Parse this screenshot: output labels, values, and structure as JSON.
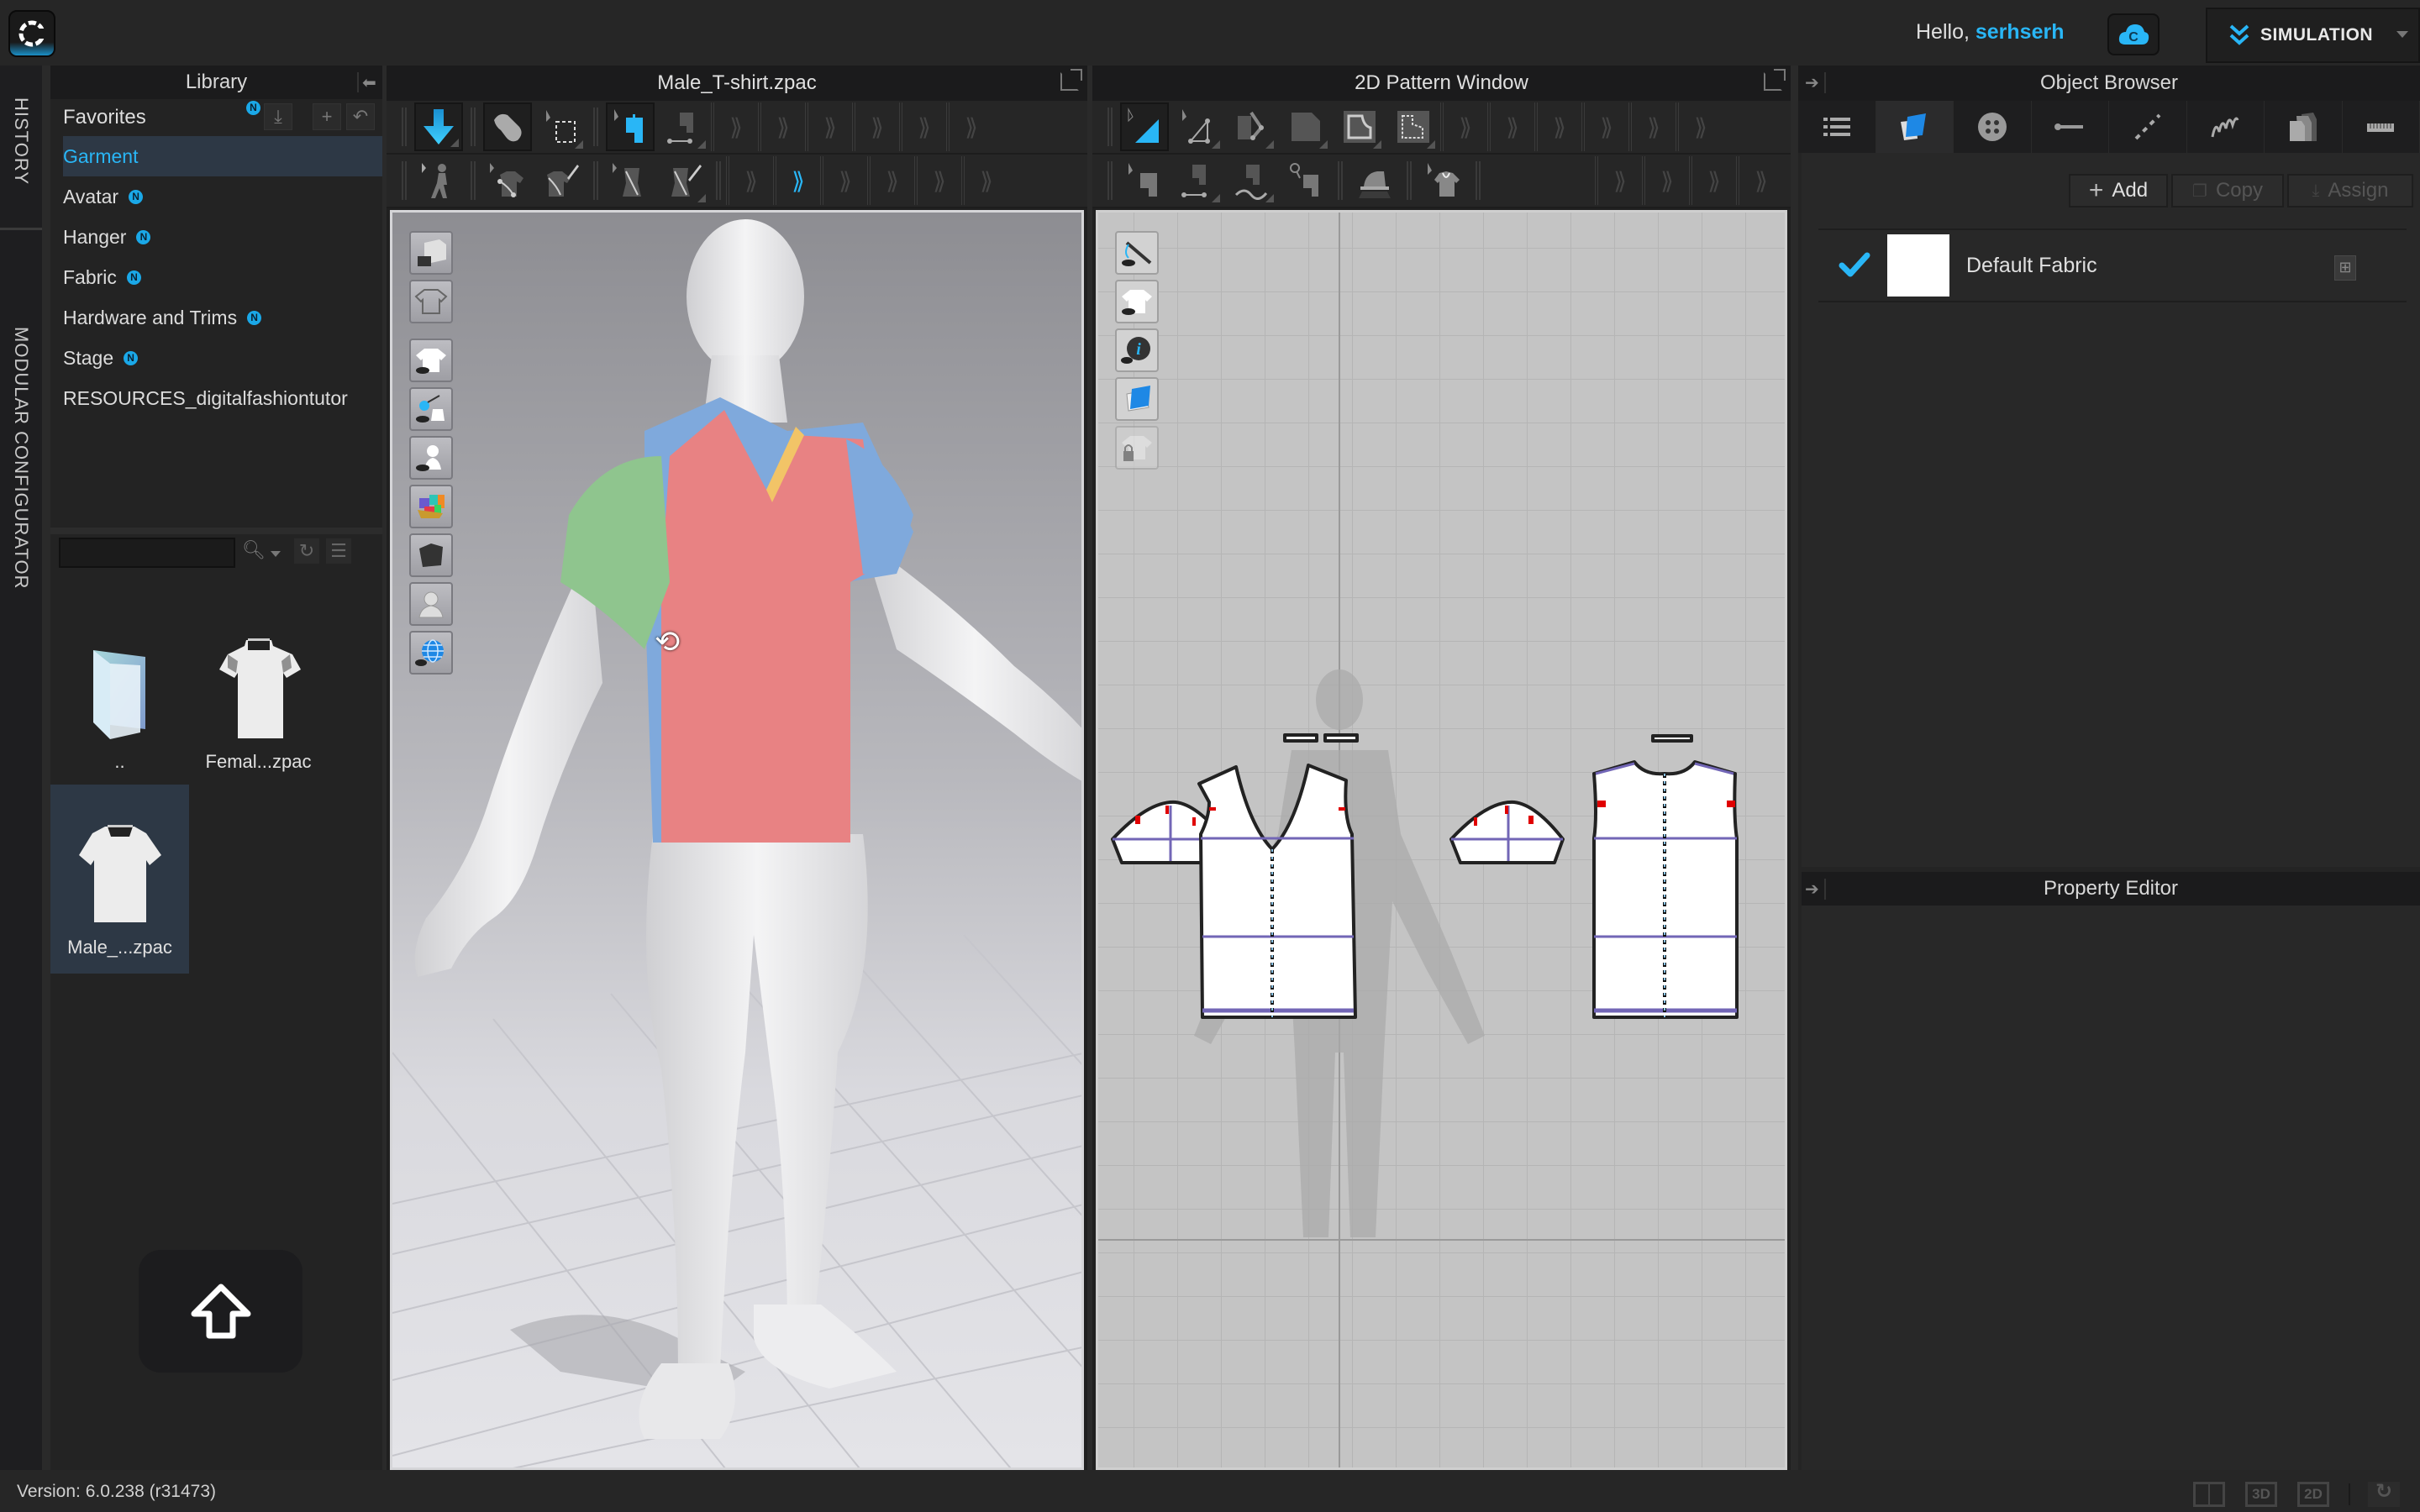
{
  "app": {
    "logo_icon": "clo-logo-icon",
    "greeting_prefix": "Hello, ",
    "username": "serhserh",
    "cloud_icon": "clo-set-cloud-icon",
    "mode_label": "SIMULATION",
    "accent_color": "#29b6f6"
  },
  "side_tabs": [
    "HISTORY",
    "MODULAR CONFIGURATOR"
  ],
  "library": {
    "title": "Library",
    "favorites_label": "Favorites",
    "new_badge": "N",
    "items": [
      {
        "label": "Garment",
        "selected": true,
        "new": false
      },
      {
        "label": "Avatar",
        "new": true
      },
      {
        "label": "Hanger",
        "new": true
      },
      {
        "label": "Fabric",
        "new": true
      },
      {
        "label": "Hardware and Trims",
        "new": true
      },
      {
        "label": "Stage",
        "new": true
      },
      {
        "label": "RESOURCES_digitalfashiontutor",
        "new": false
      }
    ],
    "search_value": "",
    "files": [
      {
        "name": "..",
        "icon": "folder-up-icon"
      },
      {
        "name": "Femal...zpac",
        "icon": "tshirt-thumbnail-icon"
      },
      {
        "name": "Male_...zpac",
        "icon": "tshirt-thumbnail-icon",
        "selected": true
      }
    ]
  },
  "window3d": {
    "title": "Male_T-shirt.zpac",
    "garment_colors": {
      "front": "#e88283",
      "sleeve_left": "#8fc58e",
      "back": "#7fa9dc",
      "collar": "#f2c467"
    }
  },
  "window2d": {
    "title": "2D Pattern Window"
  },
  "object_browser": {
    "title": "Object Browser",
    "tabs": [
      "list-icon",
      "fabric-icon",
      "button-icon",
      "buttonhole-icon",
      "topstitch-icon",
      "zipper-icon",
      "pattern-pieces-icon",
      "measure-icon"
    ],
    "active_tab": 1,
    "add_label": "Add",
    "copy_label": "Copy",
    "assign_label": "Assign",
    "fabrics": [
      {
        "name": "Default Fabric",
        "checked": true,
        "swatch": "#ffffff"
      }
    ]
  },
  "property_editor": {
    "title": "Property Editor"
  },
  "status": {
    "version": "Version: 6.0.238 (r31473)",
    "view_3d": "3D",
    "view_2d": "2D"
  }
}
